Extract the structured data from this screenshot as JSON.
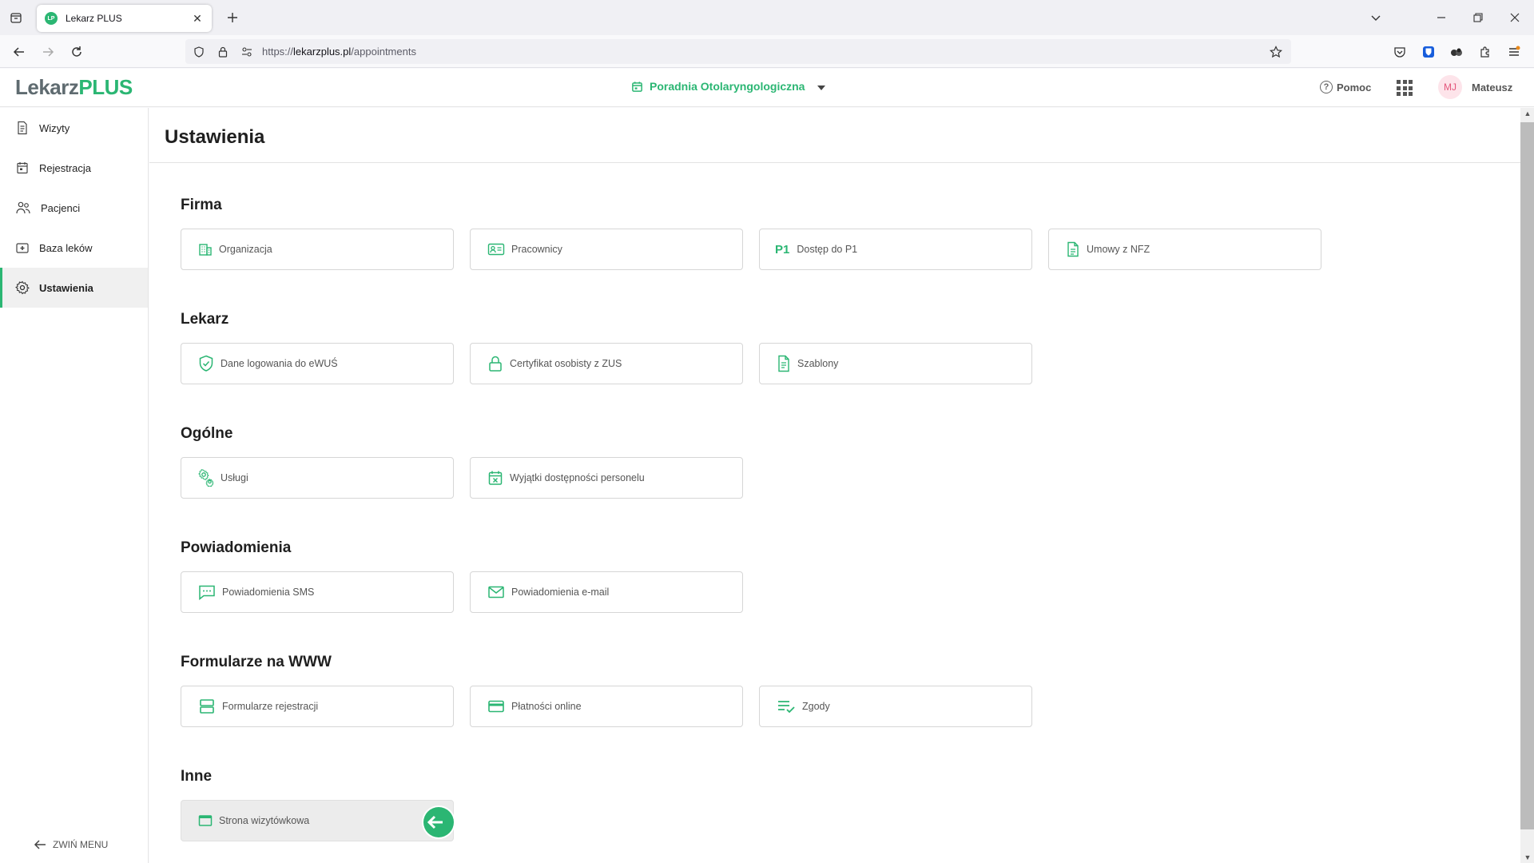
{
  "browser": {
    "tab_title": "Lekarz PLUS",
    "tab_favicon": "LP",
    "url_prefix": "https://",
    "url_domain": "lekarzplus.pl",
    "url_path": "/appointments"
  },
  "header": {
    "logo_part1": "Lekarz",
    "logo_part2": "PLUS",
    "clinic": "Poradnia Otolaryngologiczna",
    "help": "Pomoc",
    "user_initials": "MJ",
    "user_name": "Mateusz"
  },
  "sidebar": {
    "items": [
      {
        "label": "Wizyty",
        "icon": "document-list-icon"
      },
      {
        "label": "Rejestracja",
        "icon": "calendar-icon"
      },
      {
        "label": "Pacjenci",
        "icon": "people-icon"
      },
      {
        "label": "Baza leków",
        "icon": "medical-kit-icon"
      },
      {
        "label": "Ustawienia",
        "icon": "gear-icon",
        "active": true
      }
    ],
    "collapse": "ZWIŃ MENU"
  },
  "main": {
    "title": "Ustawienia",
    "sections": [
      {
        "title": "Firma",
        "cards": [
          "Organizacja",
          "Pracownicy",
          "Dostęp do P1",
          "Umowy z NFZ"
        ]
      },
      {
        "title": "Lekarz",
        "cards": [
          "Dane logowania do eWUŚ",
          "Certyfikat osobisty z ZUS",
          "Szablony"
        ]
      },
      {
        "title": "Ogólne",
        "cards": [
          "Usługi",
          "Wyjątki dostępności personelu"
        ]
      },
      {
        "title": "Powiadomienia",
        "cards": [
          "Powiadomienia SMS",
          "Powiadomienia e-mail"
        ]
      },
      {
        "title": "Formularze na WWW",
        "cards": [
          "Formularze rejestracji",
          "Płatności online",
          "Zgody"
        ]
      },
      {
        "title": "Inne",
        "cards": [
          "Strona wizytówkowa"
        ]
      }
    ],
    "p1_badge": "P1"
  },
  "colors": {
    "accent": "#2bb673",
    "active_bg": "#f0f0f0",
    "text": "#1f1f1f"
  }
}
